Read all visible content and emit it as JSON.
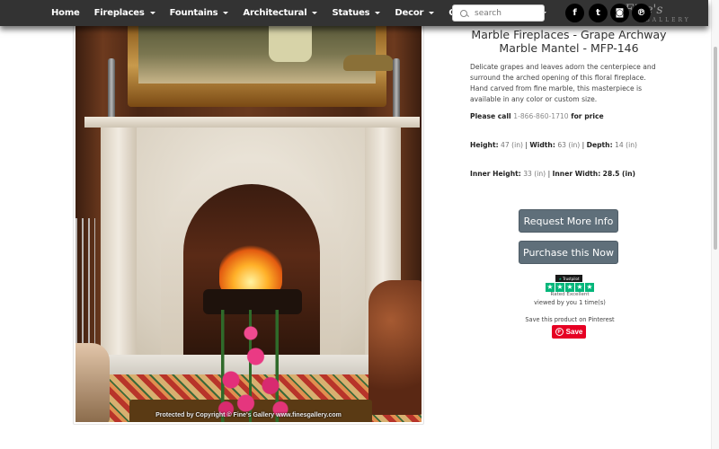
{
  "nav": {
    "items": [
      {
        "label": "Home",
        "has_dropdown": false
      },
      {
        "label": "Fireplaces",
        "has_dropdown": true
      },
      {
        "label": "Fountains",
        "has_dropdown": true
      },
      {
        "label": "Architectural",
        "has_dropdown": true
      },
      {
        "label": "Statues",
        "has_dropdown": true
      },
      {
        "label": "Decor",
        "has_dropdown": true
      },
      {
        "label": "Contact",
        "has_dropdown": false
      },
      {
        "label": "More...",
        "has_dropdown": true
      }
    ],
    "search": {
      "placeholder": "search",
      "value": "",
      "icon": "search-icon"
    },
    "social": [
      {
        "name": "facebook",
        "glyph": "f"
      },
      {
        "name": "twitter",
        "glyph": "t"
      },
      {
        "name": "instagram",
        "glyph": "◙"
      },
      {
        "name": "pinterest",
        "glyph": "℗"
      }
    ],
    "logo": {
      "text": "Fine's",
      "subtext": "GALLERY"
    }
  },
  "product": {
    "image_watermark": "Protected by Copyright © Fine's Gallery www.finesgallery.com",
    "title": "Marble Fireplaces - Grape Archway Marble Mantel - MFP-146",
    "description": "Delicate grapes and leaves adorn the centerpiece and surround the arched opening of this floral fireplace. Hand carved from fine marble, this masterpiece is available in any color or custom size.",
    "price_prefix": "Please call",
    "phone": "1-866-860-1710",
    "price_suffix": "for price",
    "dimensions": {
      "height_label": "Height:",
      "height_value": "47 (in)",
      "width_label": "Width:",
      "width_value": "63 (in)",
      "depth_label": "Depth:",
      "depth_value": "14 (in)",
      "separator": "|"
    },
    "inner_dimensions": {
      "inner_height_label": "Inner Height:",
      "inner_height_value": "33 (in)",
      "inner_width_label": "Inner Width:",
      "inner_width_value": "28.5 (in)",
      "separator": "|"
    },
    "buttons": {
      "request": "Request More Info",
      "purchase": "Purchase this Now"
    },
    "trustpilot": {
      "badge": "Trustpilot",
      "stars": 5,
      "rating_text": "Rated Excellent",
      "viewed_text": "viewed by you 1 time(s)"
    },
    "pinterest": {
      "prompt": "Save this product on Pinterest",
      "button": "Save"
    }
  },
  "colors": {
    "navbar": "#333333",
    "button": "#5f6f7a",
    "trustpilot_green": "#00b67a",
    "pinterest_red": "#e60023"
  }
}
